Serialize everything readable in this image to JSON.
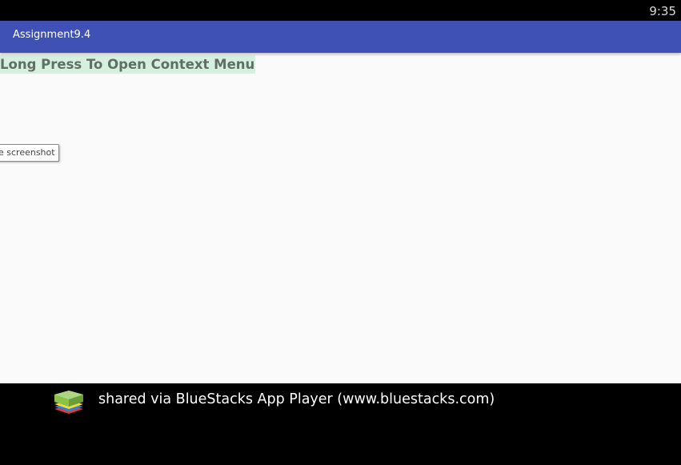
{
  "status_bar": {
    "time": "9:35"
  },
  "app_bar": {
    "title": "Assignment9.4"
  },
  "main": {
    "context_menu_text": "Long Press To Open Context Menu",
    "tooltip_text": "e screenshot"
  },
  "footer": {
    "logo_icon": "bluestacks-logo-icon",
    "text": "shared via BlueStacks App Player (www.bluestacks.com)"
  },
  "colors": {
    "app_bar": "#3f51b5",
    "content_background": "#fafafa",
    "text_highlight": "#d6f0de",
    "text_color": "#5f6f66"
  }
}
